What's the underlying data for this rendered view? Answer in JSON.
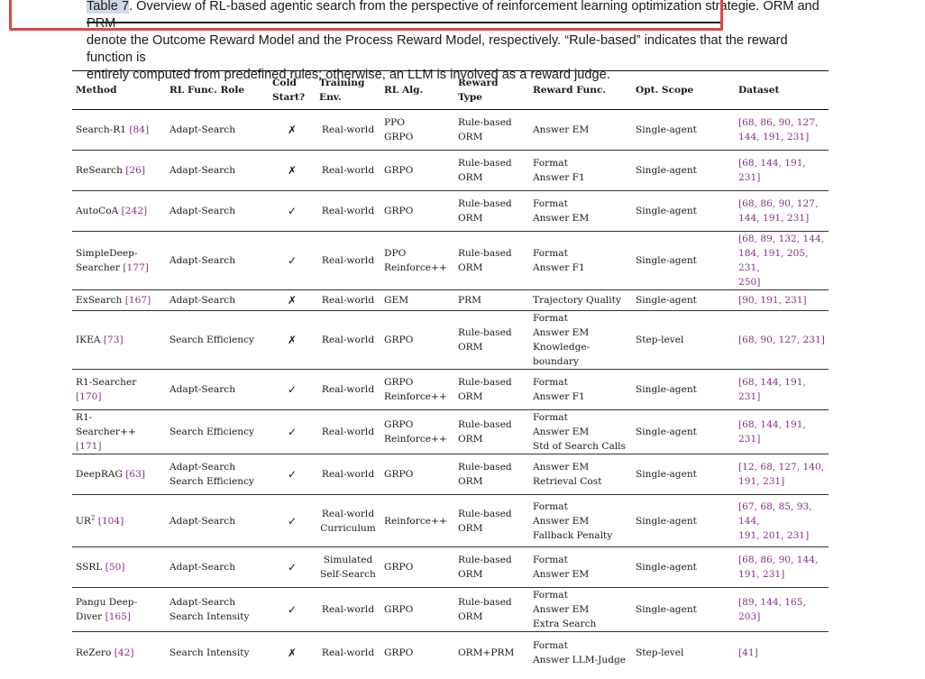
{
  "caption": {
    "label": "Table 7",
    "line1_rest": ". Overview of RL-based agentic search from the perspective of reinforcement learning optimization strategie",
    "line1_end": ". ORM and PRM",
    "line2_obscured": "denote the Outcome Reward Model and the Process Reward Model, respectively. “Rule-based” indicates that the r",
    "line2_rest": "eward function is",
    "line3": "entirely computed from predefined rules; otherwise, an LLM is involved as a reward judge."
  },
  "headers": {
    "method": "Method",
    "role": "RL Func. Role",
    "cold": [
      "Cold",
      "Start?"
    ],
    "env": [
      "Training",
      "Env."
    ],
    "alg": "RL Alg.",
    "rtype": [
      "Reward",
      "Type"
    ],
    "rfunc": "Reward Func.",
    "scope": "Opt. Scope",
    "dataset": "Dataset"
  },
  "rows": [
    {
      "method": "Search-R1",
      "cite": "[84]",
      "role": [
        "Adapt-Search"
      ],
      "cold": "✗",
      "env": [
        "Real-world"
      ],
      "alg": [
        "PPO",
        "GRPO"
      ],
      "rtype": [
        "Rule-based",
        "ORM"
      ],
      "rfunc": [
        "Answer EM"
      ],
      "scope": "Single-agent",
      "dataset": [
        "[68, 86, 90, 127,",
        "144, 191, 231]"
      ]
    },
    {
      "method": "ReSearch",
      "cite": "[26]",
      "role": [
        "Adapt-Search"
      ],
      "cold": "✗",
      "env": [
        "Real-world"
      ],
      "alg": [
        "GRPO"
      ],
      "rtype": [
        "Rule-based",
        "ORM"
      ],
      "rfunc": [
        "Format",
        "Answer F1"
      ],
      "scope": "Single-agent",
      "dataset": [
        "[68, 144, 191, 231]"
      ]
    },
    {
      "method": "AutoCoA",
      "cite": "[242]",
      "role": [
        "Adapt-Search"
      ],
      "cold": "✓",
      "env": [
        "Real-world"
      ],
      "alg": [
        "GRPO"
      ],
      "rtype": [
        "Rule-based",
        "ORM"
      ],
      "rfunc": [
        "Format",
        "Answer EM"
      ],
      "scope": "Single-agent",
      "dataset": [
        "[68, 86, 90, 127,",
        "144, 191, 231]"
      ]
    },
    {
      "method": "SimpleDeep-",
      "method2": "Searcher",
      "cite": "[177]",
      "role": [
        "Adapt-Search"
      ],
      "cold": "✓",
      "env": [
        "Real-world"
      ],
      "alg": [
        "DPO",
        "Reinforce++"
      ],
      "rtype": [
        "Rule-based",
        "ORM"
      ],
      "rfunc": [
        "Format",
        "Answer F1"
      ],
      "scope": "Single-agent",
      "dataset": [
        "[68, 89, 132, 144,",
        "184, 191, 205, 231,",
        "250]"
      ]
    },
    {
      "method": "ExSearch",
      "cite": "[167]",
      "role": [
        "Adapt-Search"
      ],
      "cold": "✗",
      "env": [
        "Real-world"
      ],
      "alg": [
        "GEM"
      ],
      "rtype": [
        "PRM"
      ],
      "rfunc": [
        "Trajectory Quality"
      ],
      "scope": "Single-agent",
      "dataset": [
        "[90, 191, 231]"
      ]
    },
    {
      "method": "IKEA",
      "cite": "[73]",
      "role": [
        "Search Efficiency"
      ],
      "cold": "✗",
      "env": [
        "Real-world"
      ],
      "alg": [
        "GRPO"
      ],
      "rtype": [
        "Rule-based",
        "ORM"
      ],
      "rfunc": [
        "Format",
        "Answer EM",
        "Knowledge-boundary"
      ],
      "scope": "Step-level",
      "dataset": [
        "[68, 90, 127, 231]"
      ]
    },
    {
      "method": "R1-Searcher",
      "cite": "[170]",
      "role": [
        "Adapt-Search"
      ],
      "cold": "✓",
      "env": [
        "Real-world"
      ],
      "alg": [
        "GRPO",
        "Reinforce++"
      ],
      "rtype": [
        "Rule-based",
        "ORM"
      ],
      "rfunc": [
        "Format",
        "Answer F1"
      ],
      "scope": "Single-agent",
      "dataset": [
        "[68, 144, 191, 231]"
      ]
    },
    {
      "method": "R1-",
      "method2": "Searcher++",
      "cite": "[171]",
      "role": [
        "Search Efficiency"
      ],
      "cold": "✓",
      "env": [
        "Real-world"
      ],
      "alg": [
        "GRPO",
        "Reinforce++"
      ],
      "rtype": [
        "Rule-based",
        "ORM"
      ],
      "rfunc": [
        "Format",
        "Answer EM",
        "Std of Search Calls"
      ],
      "scope": "Single-agent",
      "dataset": [
        "[68, 144, 191, 231]"
      ]
    },
    {
      "method": "DeepRAG",
      "cite": "[63]",
      "role": [
        "Adapt-Search",
        "Search Efficiency"
      ],
      "cold": "✓",
      "env": [
        "Real-world"
      ],
      "alg": [
        "GRPO"
      ],
      "rtype": [
        "Rule-based",
        "ORM"
      ],
      "rfunc": [
        "Answer EM",
        "Retrieval Cost"
      ],
      "scope": "Single-agent",
      "dataset": [
        "[12, 68, 127, 140,",
        "191, 231]"
      ]
    },
    {
      "method": "UR",
      "sup": "2",
      "cite": "[104]",
      "role": [
        "Adapt-Search"
      ],
      "cold": "✓",
      "env": [
        "Real-world",
        "Curriculum"
      ],
      "alg": [
        "Reinforce++"
      ],
      "rtype": [
        "Rule-based",
        "ORM"
      ],
      "rfunc": [
        "Format",
        "Answer EM",
        "Fallback Penalty"
      ],
      "scope": "Single-agent",
      "dataset": [
        "[67, 68, 85, 93, 144,",
        "191, 201, 231]"
      ]
    },
    {
      "method": "SSRL",
      "cite": "[50]",
      "role": [
        "Adapt-Search"
      ],
      "cold": "✓",
      "env": [
        "Simulated",
        "Self-Search"
      ],
      "alg": [
        "GRPO"
      ],
      "rtype": [
        "Rule-based",
        "ORM"
      ],
      "rfunc": [
        "Format",
        "Answer EM"
      ],
      "scope": "Single-agent",
      "dataset": [
        "[68, 86, 90, 144,",
        "191, 231]"
      ]
    },
    {
      "method": "Pangu Deep-",
      "method2": "Diver",
      "cite": "[165]",
      "role": [
        "Adapt-Search",
        "Search Intensity"
      ],
      "cold": "✓",
      "env": [
        "Real-world"
      ],
      "alg": [
        "GRPO"
      ],
      "rtype": [
        "Rule-based",
        "ORM"
      ],
      "rfunc": [
        "Format",
        "Answer EM",
        "Extra Search"
      ],
      "scope": "Single-agent",
      "dataset": [
        "[89, 144, 165, 203]"
      ]
    },
    {
      "method": "ReZero",
      "cite": "[42]",
      "role": [
        "Search Intensity"
      ],
      "cold": "✗",
      "env": [
        "Real-world"
      ],
      "alg": [
        "GRPO"
      ],
      "rtype": [
        "ORM+PRM"
      ],
      "rfunc": [
        "Format",
        "Answer LLM-Judge"
      ],
      "scope": "Step-level",
      "dataset": [
        "[41]"
      ]
    }
  ]
}
